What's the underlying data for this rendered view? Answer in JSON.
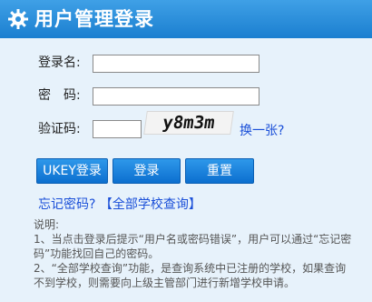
{
  "header": {
    "title": "用户管理登录",
    "icon": "gear-icon"
  },
  "form": {
    "username_label": "登录名:",
    "username_value": "",
    "password_label": "密　码:",
    "password_value": "",
    "captcha_label": "验证码:",
    "captcha_value": "",
    "captcha_text": "y8m3m",
    "refresh_link": "换一张?"
  },
  "buttons": {
    "ukey": "UKEY登录",
    "login": "登录",
    "reset": "重置"
  },
  "links": {
    "forgot": "忘记密码?",
    "school_query": "【全部学校查询】"
  },
  "notes": {
    "heading": "说明:",
    "line1": "1、当点击登录后提示“用户名或密码错误”，用户可以通过“忘记密码”功能找回自己的密码。",
    "line2": "2、“全部学校查询”功能，是查询系统中已注册的学校，如果查询不到学校，则需要向上级主管部门进行新增学校申请。"
  },
  "colors": {
    "header": "#2389d8",
    "panel": "#e7f2fb",
    "button": "#1d84de",
    "link": "#1a4fd8"
  }
}
